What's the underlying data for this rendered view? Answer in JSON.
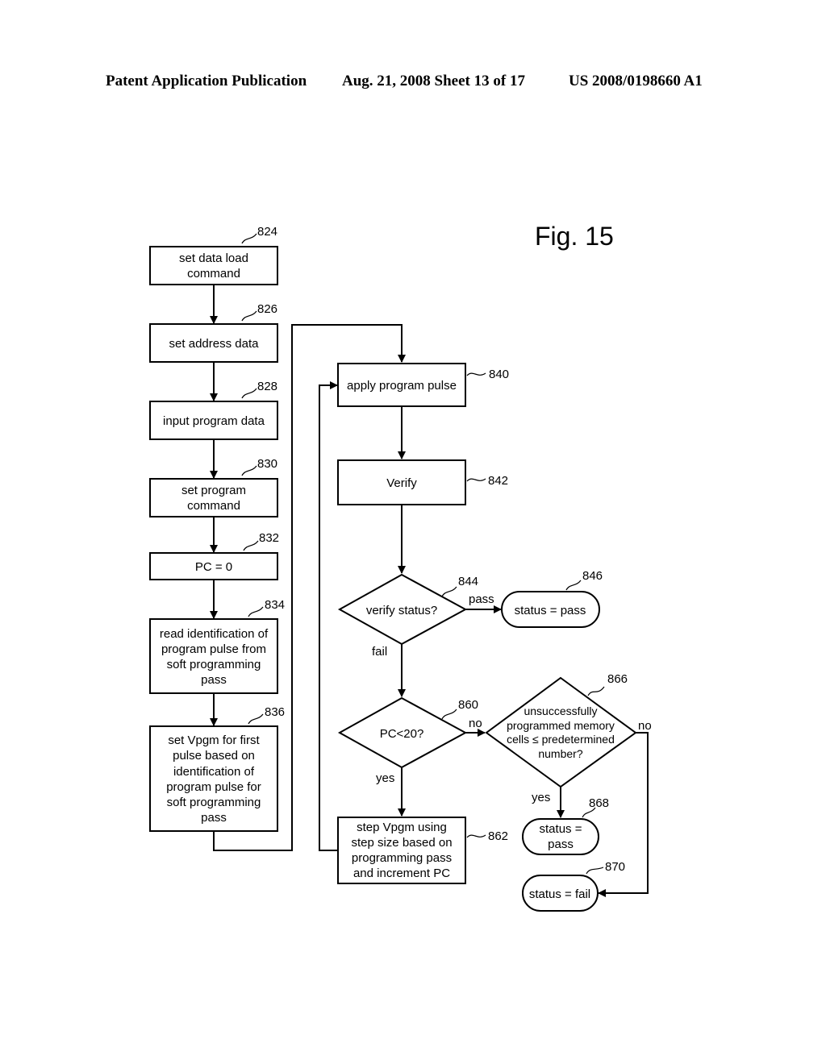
{
  "header": {
    "publication": "Patent Application Publication",
    "date_sheet": "Aug. 21, 2008  Sheet 13 of 17",
    "number": "US 2008/0198660 A1"
  },
  "figure_label": "Fig. 15",
  "nodes": {
    "n824": {
      "ref": "824",
      "shape": "process",
      "lines": [
        "set data load",
        "command"
      ]
    },
    "n826": {
      "ref": "826",
      "shape": "process",
      "lines": [
        "set address data"
      ]
    },
    "n828": {
      "ref": "828",
      "shape": "process",
      "lines": [
        "input program data"
      ]
    },
    "n830": {
      "ref": "830",
      "shape": "process",
      "lines": [
        "set program",
        "command"
      ]
    },
    "n832": {
      "ref": "832",
      "shape": "process",
      "lines": [
        "PC = 0"
      ]
    },
    "n834": {
      "ref": "834",
      "shape": "process",
      "lines": [
        "read identification of",
        "program pulse from",
        "soft programming",
        "pass"
      ]
    },
    "n836": {
      "ref": "836",
      "shape": "process",
      "lines": [
        "set Vpgm for first",
        "pulse based on",
        "identification of",
        "program pulse for",
        "soft programming",
        "pass"
      ]
    },
    "n840": {
      "ref": "840",
      "shape": "process",
      "lines": [
        "apply program pulse"
      ]
    },
    "n842": {
      "ref": "842",
      "shape": "process",
      "lines": [
        "Verify"
      ]
    },
    "n844": {
      "ref": "844",
      "shape": "decision",
      "lines": [
        "verify status?"
      ]
    },
    "n846": {
      "ref": "846",
      "shape": "terminal",
      "lines": [
        "status = pass"
      ]
    },
    "n860": {
      "ref": "860",
      "shape": "decision",
      "lines": [
        "PC<20?"
      ]
    },
    "n862": {
      "ref": "862",
      "shape": "process",
      "lines": [
        "step Vpgm using",
        "step size based on",
        "programming pass",
        "and increment PC"
      ]
    },
    "n866": {
      "ref": "866",
      "shape": "decision",
      "lines": [
        "unsuccessfully",
        "programmed memory",
        "cells ≤ predetermined",
        "number?"
      ]
    },
    "n868": {
      "ref": "868",
      "shape": "terminal",
      "lines": [
        "status =",
        "pass"
      ]
    },
    "n870": {
      "ref": "870",
      "shape": "terminal",
      "lines": [
        "status = fail"
      ]
    }
  },
  "edges": [
    {
      "from": "824",
      "to": "826",
      "label": ""
    },
    {
      "from": "826",
      "to": "828",
      "label": ""
    },
    {
      "from": "828",
      "to": "830",
      "label": ""
    },
    {
      "from": "830",
      "to": "832",
      "label": ""
    },
    {
      "from": "832",
      "to": "834",
      "label": ""
    },
    {
      "from": "834",
      "to": "836",
      "label": ""
    },
    {
      "from": "836",
      "to": "840",
      "label": ""
    },
    {
      "from": "840",
      "to": "842",
      "label": ""
    },
    {
      "from": "842",
      "to": "844",
      "label": ""
    },
    {
      "from": "844",
      "to": "846",
      "label": "pass"
    },
    {
      "from": "844",
      "to": "860",
      "label": "fail"
    },
    {
      "from": "860",
      "to": "862",
      "label": "yes"
    },
    {
      "from": "860",
      "to": "866",
      "label": "no"
    },
    {
      "from": "862",
      "to": "840",
      "label": ""
    },
    {
      "from": "866",
      "to": "868",
      "label": "yes"
    },
    {
      "from": "866",
      "to": "870",
      "label": "no"
    }
  ],
  "edge_labels": {
    "e844_pass": "pass",
    "e844_fail": "fail",
    "e860_yes": "yes",
    "e860_no": "no",
    "e866_yes": "yes",
    "e866_no": "no"
  }
}
